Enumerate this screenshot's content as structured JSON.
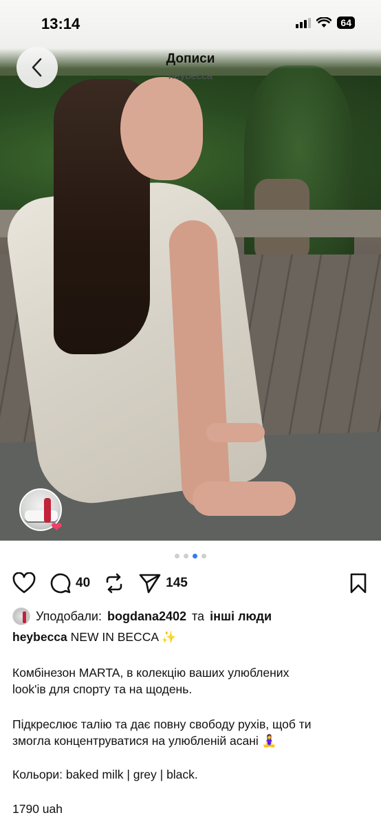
{
  "status_bar": {
    "time": "13:14",
    "battery": "64"
  },
  "header": {
    "title": "Дописи",
    "subtitle": "heybecca"
  },
  "carousel": {
    "total": 4,
    "active_index": 2
  },
  "actions": {
    "comments_count": "40",
    "shares_count": "145"
  },
  "likes": {
    "prefix": "Уподобали:",
    "first_user": "bogdana2402",
    "joiner": "та",
    "others": "інші люди"
  },
  "caption": {
    "username": "heybecca",
    "headline": "NEW IN BECCA ✨",
    "paragraph1_line1": "Комбінезон MARTA, в колекцію ваших улюблених",
    "paragraph1_line2": "look'ів для спорту та на щодень.",
    "paragraph2_line1": "Підкреслює талію та дає повну свободу рухів, щоб ти",
    "paragraph2_line2": "змогла концентруватися на улюбленій асані 🧘‍♀️",
    "colors": "Кольори: baked milk | grey | black.",
    "price": "1790 uah"
  },
  "colors": {
    "accent_dot": "#3a78f2",
    "heart": "#f0406a"
  }
}
